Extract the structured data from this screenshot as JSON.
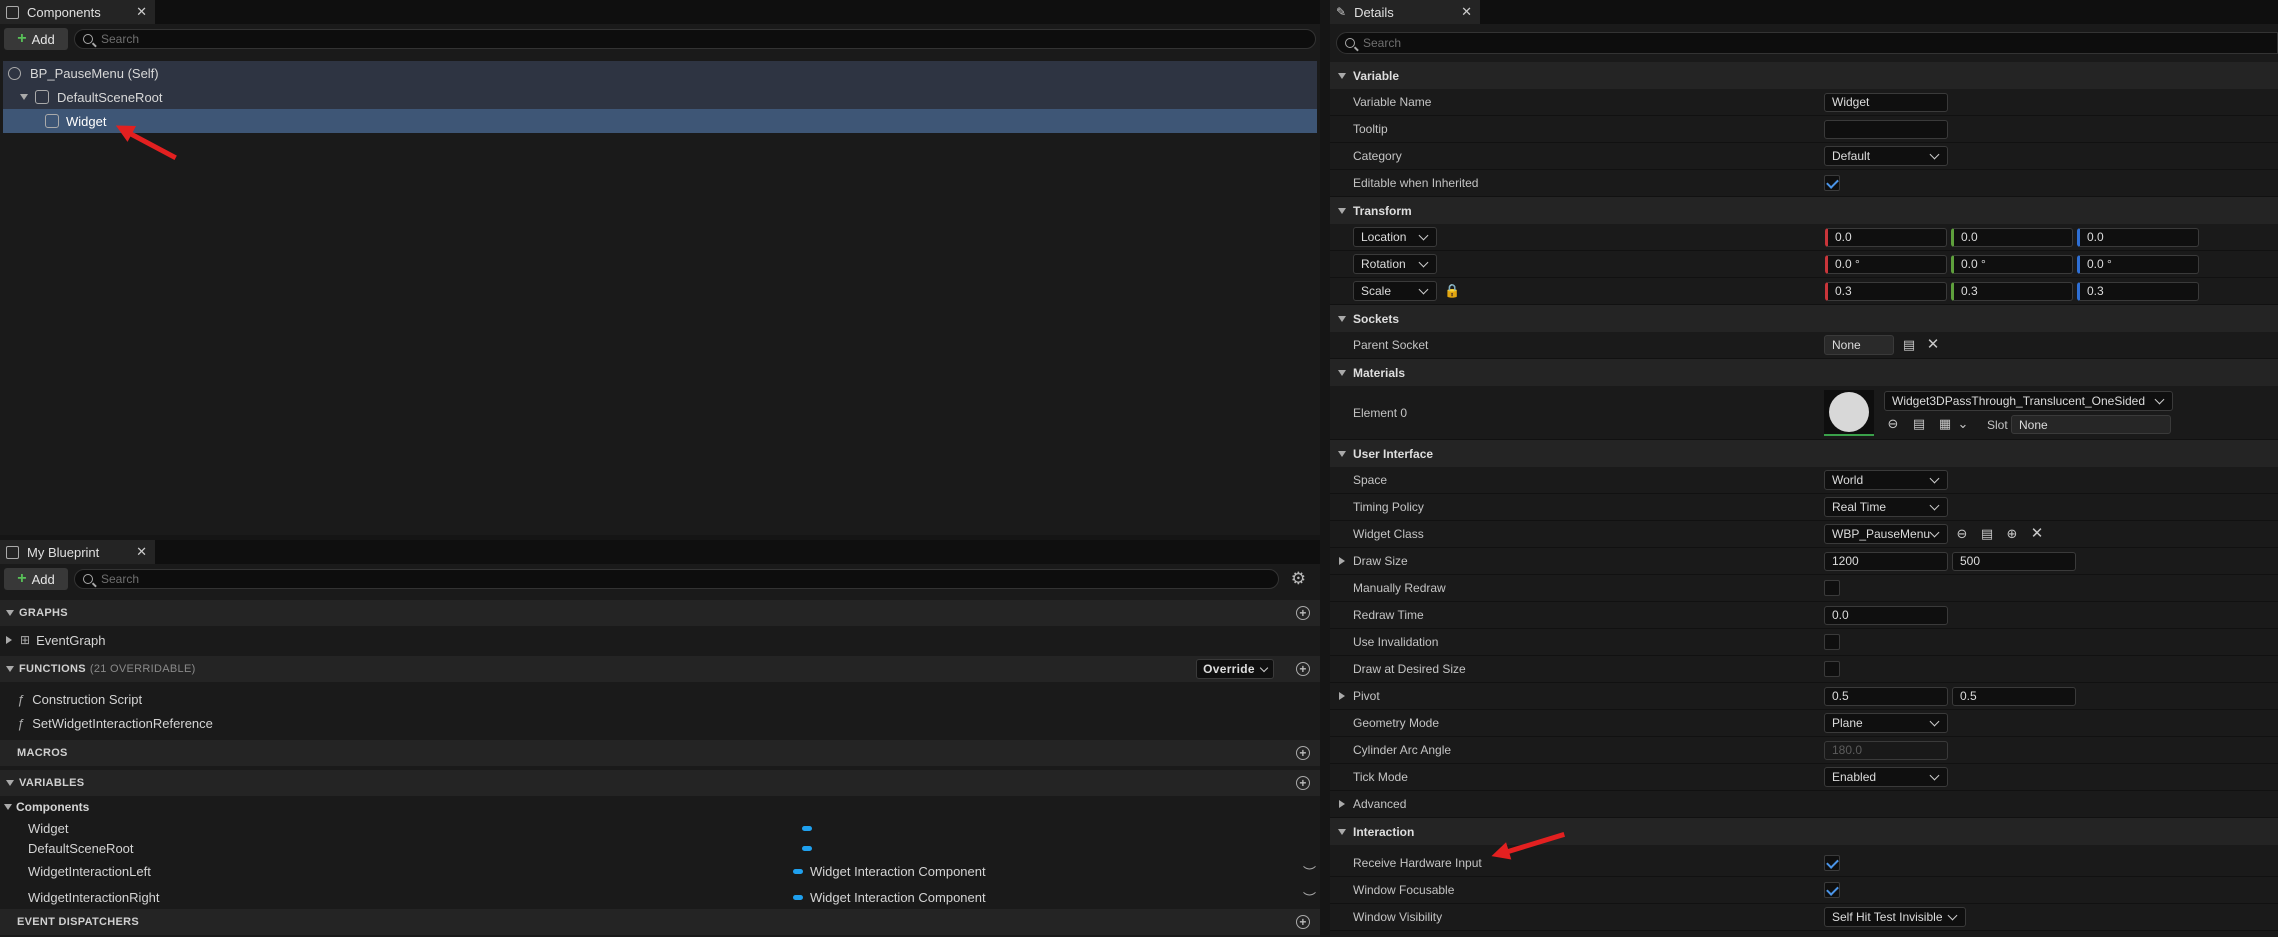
{
  "components": {
    "tab_label": "Components",
    "add_label": "Add",
    "search_placeholder": "Search",
    "tree": [
      "BP_PauseMenu (Self)",
      "DefaultSceneRoot",
      "Widget"
    ]
  },
  "blueprint": {
    "tab_label": "My Blueprint",
    "add_label": "Add",
    "search_placeholder": "Search",
    "graphs_label": "GRAPHS",
    "event_graph": "EventGraph",
    "functions_label": "FUNCTIONS",
    "functions_sub": "(21 OVERRIDABLE)",
    "override_label": "Override",
    "functions": [
      "Construction Script",
      "SetWidgetInteractionReference"
    ],
    "macros_label": "MACROS",
    "variables_label": "VARIABLES",
    "components_group": "Components",
    "variables": [
      {
        "name": "Widget",
        "type": ""
      },
      {
        "name": "DefaultSceneRoot",
        "type": ""
      },
      {
        "name": "WidgetInteractionLeft",
        "type": "Widget Interaction Component"
      },
      {
        "name": "WidgetInteractionRight",
        "type": "Widget Interaction Component"
      }
    ],
    "dispatchers_label": "EVENT DISPATCHERS"
  },
  "details": {
    "tab_label": "Details",
    "search_placeholder": "Search",
    "variable": {
      "header": "Variable",
      "name_label": "Variable Name",
      "name_value": "Widget",
      "tooltip_label": "Tooltip",
      "tooltip_value": "",
      "category_label": "Category",
      "category_value": "Default",
      "editable_label": "Editable when Inherited"
    },
    "transform": {
      "header": "Transform",
      "location_label": "Location",
      "location": [
        "0.0",
        "0.0",
        "0.0"
      ],
      "rotation_label": "Rotation",
      "rotation": [
        "0.0 °",
        "0.0 °",
        "0.0 °"
      ],
      "scale_label": "Scale",
      "scale": [
        "0.3",
        "0.3",
        "0.3"
      ]
    },
    "sockets": {
      "header": "Sockets",
      "parent_label": "Parent Socket",
      "parent_value": "None"
    },
    "materials": {
      "header": "Materials",
      "element_label": "Element 0",
      "material_value": "Widget3DPassThrough_Translucent_OneSided",
      "slot_label": "Slot",
      "slot_value": "None"
    },
    "ui": {
      "header": "User Interface",
      "space_label": "Space",
      "space_value": "World",
      "timing_label": "Timing Policy",
      "timing_value": "Real Time",
      "class_label": "Widget Class",
      "class_value": "WBP_PauseMenu",
      "drawsize_label": "Draw Size",
      "drawsize": [
        "1200",
        "500"
      ],
      "manual_label": "Manually Redraw",
      "redraw_label": "Redraw Time",
      "redraw_value": "0.0",
      "invalidation_label": "Use Invalidation",
      "desired_label": "Draw at Desired Size",
      "pivot_label": "Pivot",
      "pivot": [
        "0.5",
        "0.5"
      ],
      "geometry_label": "Geometry Mode",
      "geometry_value": "Plane",
      "arc_label": "Cylinder Arc Angle",
      "arc_value": "180.0",
      "tick_label": "Tick Mode",
      "tick_value": "Enabled",
      "advanced_label": "Advanced"
    },
    "interaction": {
      "header": "Interaction",
      "hardware_label": "Receive Hardware Input",
      "focusable_label": "Window Focusable",
      "visibility_label": "Window Visibility",
      "visibility_value": "Self Hit Test Invisible"
    }
  }
}
